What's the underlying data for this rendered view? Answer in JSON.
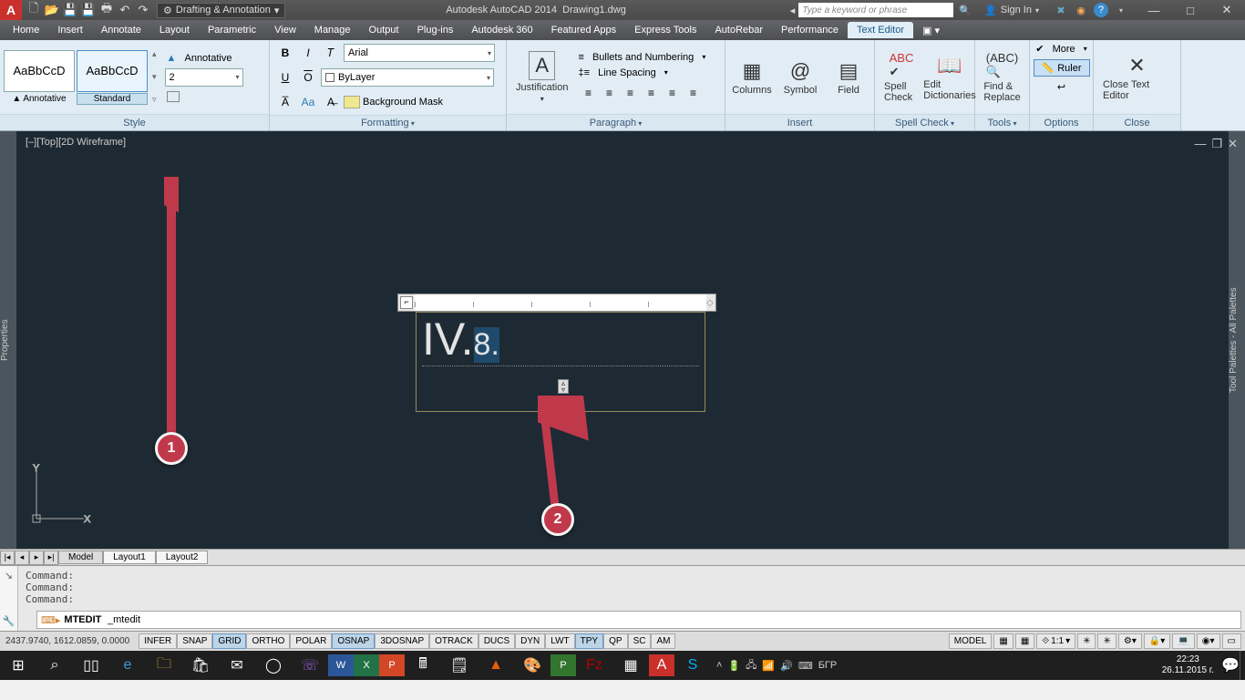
{
  "titlebar": {
    "workspace": "Drafting & Annotation",
    "app": "Autodesk AutoCAD 2014",
    "file": "Drawing1.dwg",
    "search_placeholder": "Type a keyword or phrase",
    "signin": "Sign In"
  },
  "tabs": [
    "Home",
    "Insert",
    "Annotate",
    "Layout",
    "Parametric",
    "View",
    "Manage",
    "Output",
    "Plug-ins",
    "Autodesk 360",
    "Featured Apps",
    "Express Tools",
    "AutoRebar",
    "Performance",
    "Text Editor"
  ],
  "active_tab": "Text Editor",
  "ribbon": {
    "style": {
      "annotative_btn": "Annotative",
      "annotative_sample": "AaBbCcD",
      "standard_sample": "AaBbCcD",
      "standard_btn": "Standard",
      "annotative_label": "Annotative",
      "height": "2",
      "panel": "Style"
    },
    "formatting": {
      "font": "Arial",
      "layer": "ByLayer",
      "bgmask": "Background Mask",
      "panel": "Formatting"
    },
    "paragraph": {
      "justification": "Justification",
      "bullets": "Bullets and Numbering",
      "linespacing": "Line Spacing",
      "panel": "Paragraph"
    },
    "insert": {
      "columns": "Columns",
      "symbol": "Symbol",
      "field": "Field",
      "panel": "Insert"
    },
    "spell": {
      "spell": "Spell Check",
      "dict": "Edit Dictionaries",
      "panel": "Spell Check"
    },
    "tools": {
      "find": "Find & Replace",
      "panel": "Tools"
    },
    "options": {
      "more": "More",
      "ruler": "Ruler",
      "panel": "Options"
    },
    "close": {
      "close": "Close Text Editor",
      "panel": "Close"
    }
  },
  "draw": {
    "header": "[–][Top][2D Wireframe]",
    "properties": "Properties",
    "toolpalettes": "Tool Palettes - All Palettes",
    "mtext_big": "IV.",
    "mtext_small": "8.",
    "ucs_y": "Y",
    "ucs_x": "X"
  },
  "callouts": {
    "one": "1",
    "two": "2"
  },
  "layout_tabs": [
    "Model",
    "Layout1",
    "Layout2"
  ],
  "cmd": {
    "hist": [
      "Command:",
      "Command:",
      "Command:"
    ],
    "line_label": "MTEDIT",
    "line_text": "_mtedit"
  },
  "status": {
    "coords": "2437.9740, 1612.0859, 0.0000",
    "toggles": [
      "INFER",
      "SNAP",
      "GRID",
      "ORTHO",
      "POLAR",
      "OSNAP",
      "3DOSNAP",
      "OTRACK",
      "DUCS",
      "DYN",
      "LWT",
      "TPY",
      "QP",
      "SC",
      "AM"
    ],
    "toggles_on": [
      "GRID",
      "OSNAP",
      "TPY"
    ],
    "model": "MODEL",
    "scale": "1:1",
    "lang": "БГР"
  },
  "taskbar": {
    "time": "22:23",
    "date": "26.11.2015 г."
  }
}
